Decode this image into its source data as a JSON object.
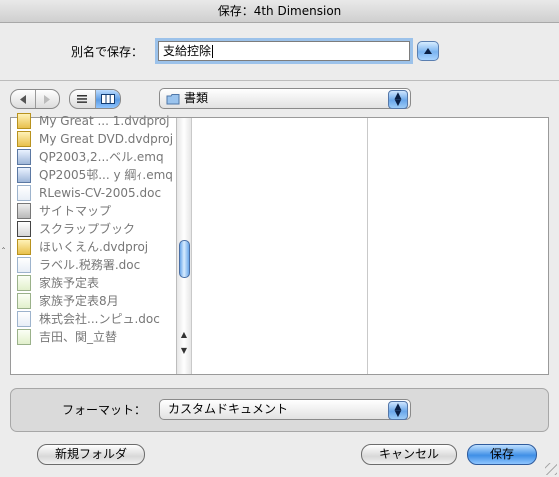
{
  "window": {
    "title": "保存：4th Dimension"
  },
  "save_as": {
    "label": "別名で保存：",
    "value": "支給控除"
  },
  "toolbar": {
    "back_icon": "back-arrow-icon",
    "forward_icon": "forward-arrow-icon",
    "list_view_icon": "list-view-icon",
    "column_view_icon": "column-view-icon",
    "location": "書類"
  },
  "files": [
    {
      "name": "My Great ... 1.dvdproj",
      "icon": "dvdproj"
    },
    {
      "name": "My Great DVD.dvdproj",
      "icon": "dvdproj"
    },
    {
      "name": "QP2003,2...ベル.emq",
      "icon": "emq"
    },
    {
      "name": "QP2005邨... y 綱ｨ.emq",
      "icon": "emq"
    },
    {
      "name": "RLewis-CV-2005.doc",
      "icon": "doc"
    },
    {
      "name": "サイトマップ",
      "icon": "site"
    },
    {
      "name": "スクラップブック",
      "icon": "clip"
    },
    {
      "name": "ほいくえん.dvdproj",
      "icon": "dvdproj"
    },
    {
      "name": "ラベル.税務署.doc",
      "icon": "doc"
    },
    {
      "name": "家族予定表",
      "icon": "txt"
    },
    {
      "name": "家族予定表8月",
      "icon": "txt"
    },
    {
      "name": "株式会社...ンピュ.doc",
      "icon": "doc"
    },
    {
      "name": "吉田、関_立替",
      "icon": "txt"
    }
  ],
  "format": {
    "label": "フォーマット：",
    "value": "カスタムドキュメント"
  },
  "buttons": {
    "new_folder": "新規フォルダ",
    "cancel": "キャンセル",
    "save": "保存"
  },
  "colors": {
    "accent": "#6aa7ea",
    "focus_ring": "#9cc2ea"
  }
}
